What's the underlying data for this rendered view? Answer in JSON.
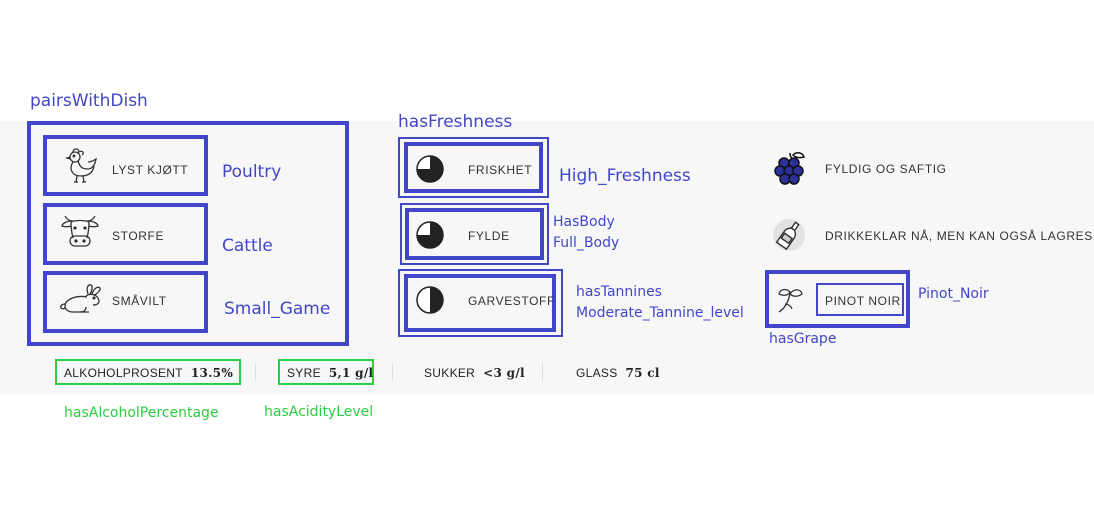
{
  "annotations": {
    "pairs_with_dish": "pairsWithDish",
    "has_freshness": "hasFreshness",
    "poultry": "Poultry",
    "cattle": "Cattle",
    "small_game": "Small_Game",
    "high_freshness": "High_Freshness",
    "has_body": "HasBody",
    "full_body": "Full_Body",
    "has_tannines": "hasTannines",
    "moderate_tannine": "Moderate_Tannine_level",
    "pinot_noir": "Pinot_Noir",
    "has_grape": "hasGrape",
    "has_alcohol_percentage": "hasAlcoholPercentage",
    "has_acidity_level": "hasAcidityLevel"
  },
  "dishes": [
    {
      "label": "LYST KJØTT",
      "icon": "chicken-icon"
    },
    {
      "label": "STORFE",
      "icon": "cow-icon"
    },
    {
      "label": "SMÅVILT",
      "icon": "rabbit-icon"
    }
  ],
  "properties": [
    {
      "label": "FRISKHET",
      "icon": "pie-gauge-icon",
      "level": 0.75
    },
    {
      "label": "FYLDE",
      "icon": "pie-gauge-icon",
      "level": 0.75
    },
    {
      "label": "GARVESTOFF",
      "icon": "pie-gauge-icon",
      "level": 0.5
    }
  ],
  "characteristics": [
    {
      "label": "FYLDIG OG SAFTIG",
      "icon": "grapes-icon"
    },
    {
      "label": "DRIKKEKLAR NÅ, MEN KAN OGSÅ LAGRES",
      "icon": "bottle-icon"
    },
    {
      "label": "PINOT NOIR",
      "icon": "vine-leaf-icon"
    }
  ],
  "stats": {
    "alcohol_label": "ALKOHOLPROSENT",
    "alcohol_value": "13.5%",
    "acid_label": "SYRE",
    "acid_value": "5,1 g/l",
    "sugar_label": "SUKKER",
    "sugar_value": "<3 g/l",
    "glass_label": "GLASS",
    "glass_value": "75 cl"
  },
  "colors": {
    "annotation_blue": "#4147c8",
    "annotation_green": "#2ecc40",
    "panel_bg": "#f7f7f7"
  }
}
